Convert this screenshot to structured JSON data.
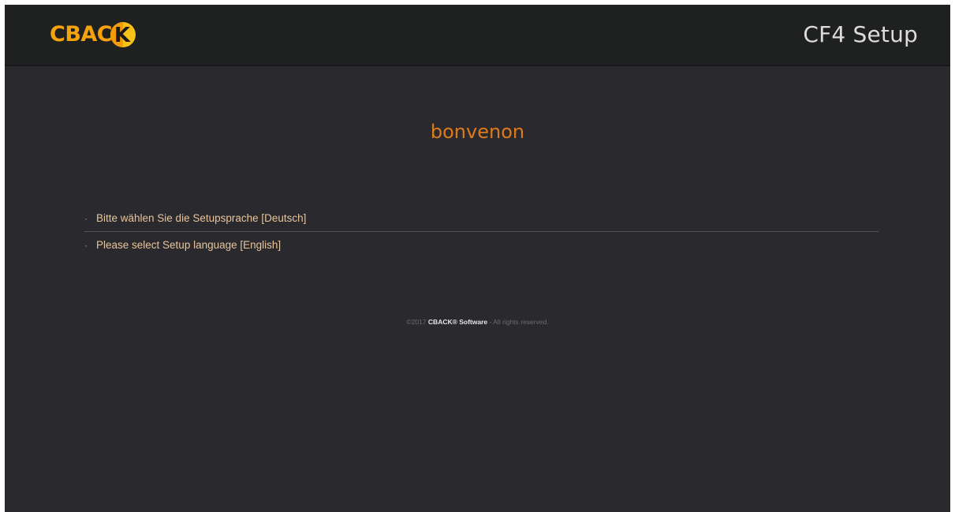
{
  "header": {
    "logo_text": "CBAC",
    "logo_badge_letter": "K",
    "title": "CF4 Setup"
  },
  "main": {
    "welcome": "bonvenon",
    "languages": [
      {
        "label": "Bitte wählen Sie die Setupsprache [Deutsch]"
      },
      {
        "label": "Please select Setup language [English]"
      }
    ],
    "bullet": "·"
  },
  "footer": {
    "copyright": "©2017",
    "brand": "CBACK® Software",
    "rights": "- All rights reserved."
  },
  "colors": {
    "background": "#2a292e",
    "header": "#1f2120",
    "accent": "#dc7a1c",
    "logo": "#f5a30c",
    "link": "#e9c59b"
  }
}
